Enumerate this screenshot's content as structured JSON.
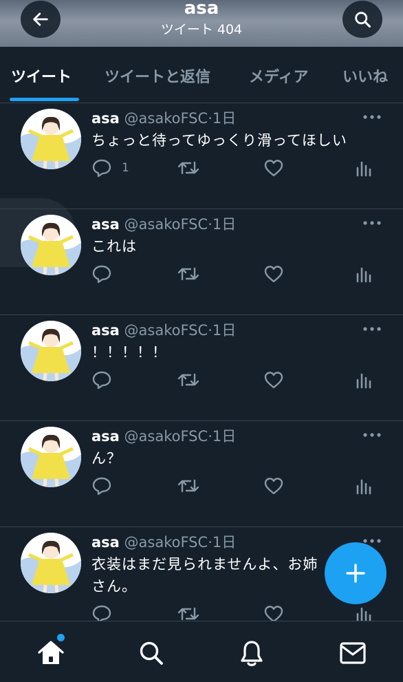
{
  "header": {
    "name": "asa",
    "tweet_count": "ツイート 404"
  },
  "tabs": [
    {
      "label": "ツイート",
      "active": true
    },
    {
      "label": "ツイートと返信",
      "active": false
    },
    {
      "label": "メディア",
      "active": false
    },
    {
      "label": "いいね",
      "active": false
    }
  ],
  "tweets": [
    {
      "name": "asa",
      "handle": "@asakoFSC",
      "time": "1日",
      "text": "ちょっと待ってゆっくり滑ってほしい",
      "reply_count": "1"
    },
    {
      "name": "asa",
      "handle": "@asakoFSC",
      "time": "1日",
      "text": "これは",
      "reply_count": ""
    },
    {
      "name": "asa",
      "handle": "@asakoFSC",
      "time": "1日",
      "text": "！！！！！",
      "reply_count": ""
    },
    {
      "name": "asa",
      "handle": "@asakoFSC",
      "time": "1日",
      "text": "ん？",
      "reply_count": ""
    },
    {
      "name": "asa",
      "handle": "@asakoFSC",
      "time": "1日",
      "text": "衣装はまだ見られませんよ、お姉さん。",
      "reply_count": ""
    }
  ],
  "tweet_separator": "·",
  "icons": {
    "back": "arrow-left-icon",
    "search": "search-icon",
    "reply": "reply-icon",
    "retweet": "retweet-icon",
    "like": "heart-icon",
    "stats": "bar-chart-icon",
    "more": "more-dots-icon",
    "compose": "plus-icon",
    "home": "home-icon",
    "explore": "search-icon",
    "notifications": "bell-icon",
    "messages": "mail-icon"
  },
  "colors": {
    "background": "#15202b",
    "accent": "#1da1f2",
    "secondary_text": "#8899a6",
    "divider": "#38444d"
  }
}
